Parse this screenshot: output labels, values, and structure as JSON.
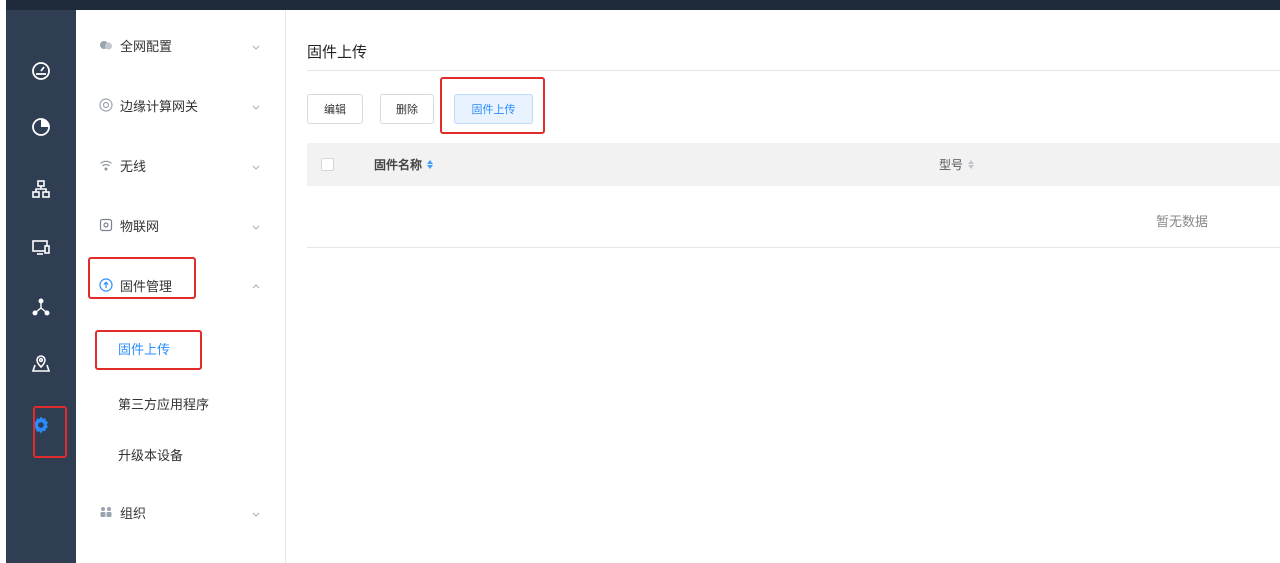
{
  "rail": {
    "items": [
      {
        "icon": "dashboard-icon"
      },
      {
        "icon": "pie-chart-icon"
      },
      {
        "icon": "network-topology-icon"
      },
      {
        "icon": "devices-icon"
      },
      {
        "icon": "nodes-icon"
      },
      {
        "icon": "map-location-icon"
      },
      {
        "icon": "gear-icon",
        "active": true
      }
    ],
    "accent": "#2a8cff"
  },
  "submenu": {
    "groups": [
      {
        "label": "全网配置",
        "icon": "global-config-icon",
        "expanded": false
      },
      {
        "label": "边缘计算网关",
        "icon": "edge-gateway-icon",
        "expanded": false
      },
      {
        "label": "无线",
        "icon": "wifi-icon",
        "expanded": false
      },
      {
        "label": "物联网",
        "icon": "iot-icon",
        "expanded": false
      },
      {
        "label": "固件管理",
        "icon": "firmware-upload-icon",
        "expanded": true
      },
      {
        "label": "组织",
        "icon": "organization-icon",
        "expanded": false
      }
    ],
    "firmware_items": [
      {
        "label": "固件上传",
        "active": true
      },
      {
        "label": "第三方应用程序",
        "active": false
      },
      {
        "label": "升级本设备",
        "active": false
      }
    ]
  },
  "main": {
    "title": "固件上传",
    "toolbar": {
      "edit_label": "编辑",
      "delete_label": "删除",
      "upload_label": "固件上传"
    },
    "table": {
      "columns": [
        {
          "label": "固件名称",
          "sortable": true,
          "sort_active": true
        },
        {
          "label": "型号",
          "sortable": true,
          "sort_active": false
        }
      ],
      "empty_text": "暂无数据"
    }
  },
  "colors": {
    "rail_bg": "#2f3e53",
    "highlight_red": "#e22b2b",
    "active_blue": "#2a8cff"
  }
}
